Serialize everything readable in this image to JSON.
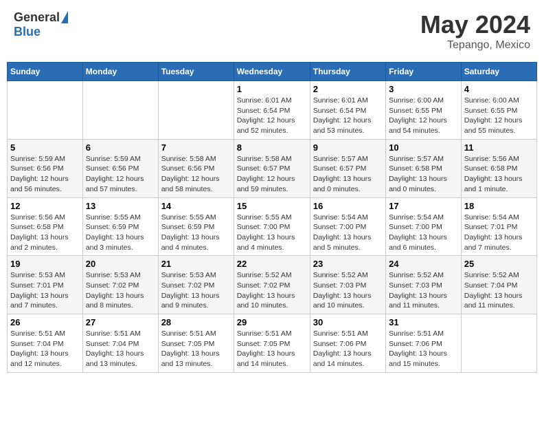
{
  "header": {
    "logo_general": "General",
    "logo_blue": "Blue",
    "month_year": "May 2024",
    "location": "Tepango, Mexico"
  },
  "days_of_week": [
    "Sunday",
    "Monday",
    "Tuesday",
    "Wednesday",
    "Thursday",
    "Friday",
    "Saturday"
  ],
  "weeks": [
    [
      {
        "day": "",
        "info": ""
      },
      {
        "day": "",
        "info": ""
      },
      {
        "day": "",
        "info": ""
      },
      {
        "day": "1",
        "info": "Sunrise: 6:01 AM\nSunset: 6:54 PM\nDaylight: 12 hours\nand 52 minutes."
      },
      {
        "day": "2",
        "info": "Sunrise: 6:01 AM\nSunset: 6:54 PM\nDaylight: 12 hours\nand 53 minutes."
      },
      {
        "day": "3",
        "info": "Sunrise: 6:00 AM\nSunset: 6:55 PM\nDaylight: 12 hours\nand 54 minutes."
      },
      {
        "day": "4",
        "info": "Sunrise: 6:00 AM\nSunset: 6:55 PM\nDaylight: 12 hours\nand 55 minutes."
      }
    ],
    [
      {
        "day": "5",
        "info": "Sunrise: 5:59 AM\nSunset: 6:56 PM\nDaylight: 12 hours\nand 56 minutes."
      },
      {
        "day": "6",
        "info": "Sunrise: 5:59 AM\nSunset: 6:56 PM\nDaylight: 12 hours\nand 57 minutes."
      },
      {
        "day": "7",
        "info": "Sunrise: 5:58 AM\nSunset: 6:56 PM\nDaylight: 12 hours\nand 58 minutes."
      },
      {
        "day": "8",
        "info": "Sunrise: 5:58 AM\nSunset: 6:57 PM\nDaylight: 12 hours\nand 59 minutes."
      },
      {
        "day": "9",
        "info": "Sunrise: 5:57 AM\nSunset: 6:57 PM\nDaylight: 13 hours\nand 0 minutes."
      },
      {
        "day": "10",
        "info": "Sunrise: 5:57 AM\nSunset: 6:58 PM\nDaylight: 13 hours\nand 0 minutes."
      },
      {
        "day": "11",
        "info": "Sunrise: 5:56 AM\nSunset: 6:58 PM\nDaylight: 13 hours\nand 1 minute."
      }
    ],
    [
      {
        "day": "12",
        "info": "Sunrise: 5:56 AM\nSunset: 6:58 PM\nDaylight: 13 hours\nand 2 minutes."
      },
      {
        "day": "13",
        "info": "Sunrise: 5:55 AM\nSunset: 6:59 PM\nDaylight: 13 hours\nand 3 minutes."
      },
      {
        "day": "14",
        "info": "Sunrise: 5:55 AM\nSunset: 6:59 PM\nDaylight: 13 hours\nand 4 minutes."
      },
      {
        "day": "15",
        "info": "Sunrise: 5:55 AM\nSunset: 7:00 PM\nDaylight: 13 hours\nand 4 minutes."
      },
      {
        "day": "16",
        "info": "Sunrise: 5:54 AM\nSunset: 7:00 PM\nDaylight: 13 hours\nand 5 minutes."
      },
      {
        "day": "17",
        "info": "Sunrise: 5:54 AM\nSunset: 7:00 PM\nDaylight: 13 hours\nand 6 minutes."
      },
      {
        "day": "18",
        "info": "Sunrise: 5:54 AM\nSunset: 7:01 PM\nDaylight: 13 hours\nand 7 minutes."
      }
    ],
    [
      {
        "day": "19",
        "info": "Sunrise: 5:53 AM\nSunset: 7:01 PM\nDaylight: 13 hours\nand 7 minutes."
      },
      {
        "day": "20",
        "info": "Sunrise: 5:53 AM\nSunset: 7:02 PM\nDaylight: 13 hours\nand 8 minutes."
      },
      {
        "day": "21",
        "info": "Sunrise: 5:53 AM\nSunset: 7:02 PM\nDaylight: 13 hours\nand 9 minutes."
      },
      {
        "day": "22",
        "info": "Sunrise: 5:52 AM\nSunset: 7:02 PM\nDaylight: 13 hours\nand 10 minutes."
      },
      {
        "day": "23",
        "info": "Sunrise: 5:52 AM\nSunset: 7:03 PM\nDaylight: 13 hours\nand 10 minutes."
      },
      {
        "day": "24",
        "info": "Sunrise: 5:52 AM\nSunset: 7:03 PM\nDaylight: 13 hours\nand 11 minutes."
      },
      {
        "day": "25",
        "info": "Sunrise: 5:52 AM\nSunset: 7:04 PM\nDaylight: 13 hours\nand 11 minutes."
      }
    ],
    [
      {
        "day": "26",
        "info": "Sunrise: 5:51 AM\nSunset: 7:04 PM\nDaylight: 13 hours\nand 12 minutes."
      },
      {
        "day": "27",
        "info": "Sunrise: 5:51 AM\nSunset: 7:04 PM\nDaylight: 13 hours\nand 13 minutes."
      },
      {
        "day": "28",
        "info": "Sunrise: 5:51 AM\nSunset: 7:05 PM\nDaylight: 13 hours\nand 13 minutes."
      },
      {
        "day": "29",
        "info": "Sunrise: 5:51 AM\nSunset: 7:05 PM\nDaylight: 13 hours\nand 14 minutes."
      },
      {
        "day": "30",
        "info": "Sunrise: 5:51 AM\nSunset: 7:06 PM\nDaylight: 13 hours\nand 14 minutes."
      },
      {
        "day": "31",
        "info": "Sunrise: 5:51 AM\nSunset: 7:06 PM\nDaylight: 13 hours\nand 15 minutes."
      },
      {
        "day": "",
        "info": ""
      }
    ]
  ]
}
